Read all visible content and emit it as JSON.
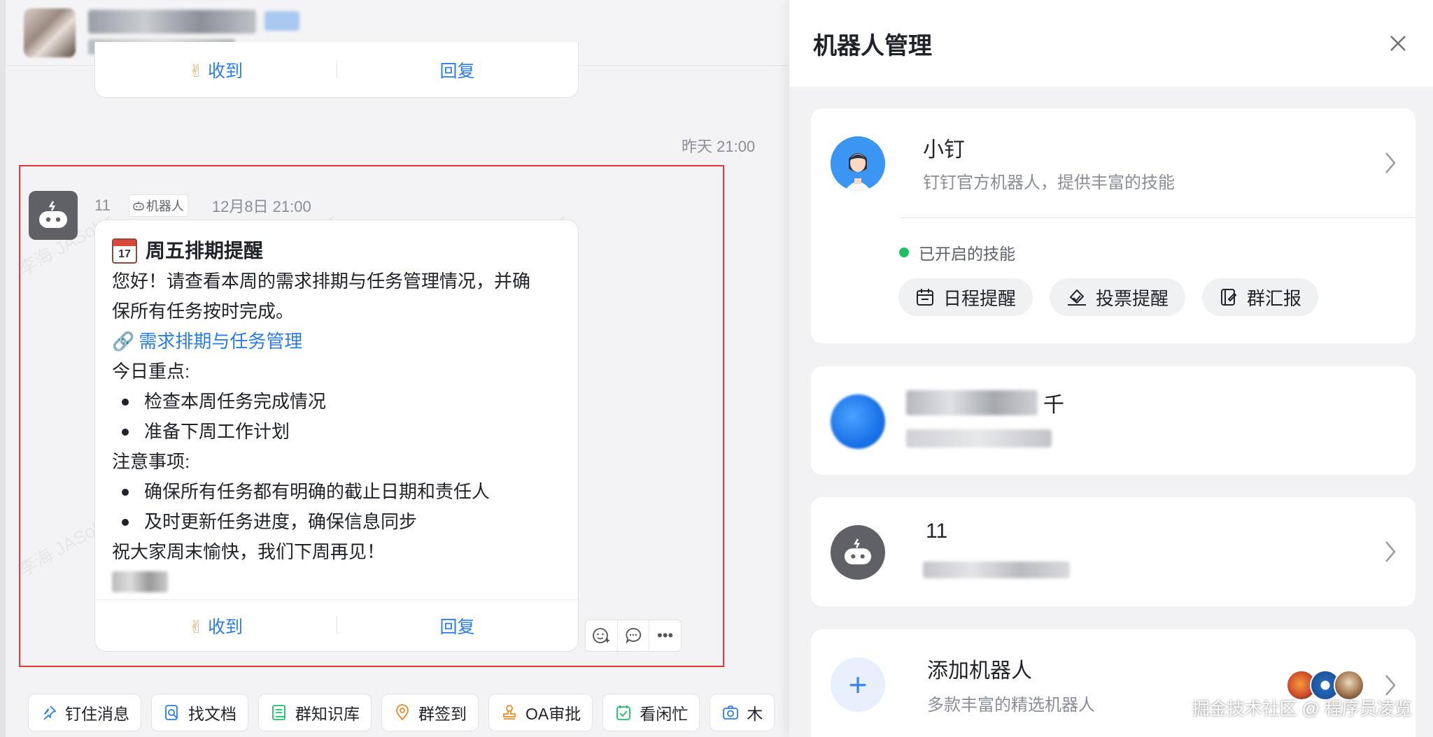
{
  "chat": {
    "prev_card": {
      "ack_label": "收到",
      "reply_label": "回复"
    },
    "time_divider": "昨天 21:00",
    "message": {
      "sender": "11",
      "sender_tag": "机器人",
      "time": "12月8日 21:00",
      "title": "周五排期提醒",
      "calendar_day": "17",
      "intro_line1": "您好！请查看本周的需求排期与任务管理情况，并确",
      "intro_line2": "保所有任务按时完成。",
      "link": "需求排期与任务管理",
      "focus_heading": "今日重点:",
      "focus_items": [
        "检查本周任务完成情况",
        "准备下周工作计划"
      ],
      "notes_heading": "注意事项:",
      "notes_items": [
        "确保所有任务都有明确的截止日期和责任人",
        "及时更新任务进度，确保信息同步"
      ],
      "closing": "祝大家周末愉快，我们下周再见！",
      "ack_label": "收到",
      "reply_label": "回复"
    },
    "quick_actions": [
      {
        "icon": "pin-icon",
        "label": "钉住消息"
      },
      {
        "icon": "doc-search-icon",
        "label": "找文档"
      },
      {
        "icon": "book-icon",
        "label": "群知识库"
      },
      {
        "icon": "location-icon",
        "label": "群签到"
      },
      {
        "icon": "stamp-icon",
        "label": "OA审批"
      },
      {
        "icon": "check-calendar-icon",
        "label": "看闲忙"
      },
      {
        "icon": "camera-icon",
        "label": "木"
      }
    ],
    "watermark": "李海 JASolar"
  },
  "panel": {
    "title": "机器人管理",
    "bots": [
      {
        "name": "小钉",
        "desc": "钉钉官方机器人，提供丰富的技能",
        "skills_heading": "已开启的技能",
        "skills": [
          {
            "icon": "calendar-icon",
            "label": "日程提醒"
          },
          {
            "icon": "vote-icon",
            "label": "投票提醒"
          },
          {
            "icon": "report-icon",
            "label": "群汇报"
          }
        ]
      },
      {
        "name": "千",
        "desc": ""
      },
      {
        "name": "11",
        "desc": ""
      },
      {
        "name": "添加机器人",
        "desc": "多款丰富的精选机器人"
      }
    ]
  },
  "footer_watermark": "掘金技术社区 @ 程序员凌览",
  "colors": {
    "accent": "#2b7de9",
    "highlight": "#e23a3a",
    "green": "#1fbf63"
  }
}
